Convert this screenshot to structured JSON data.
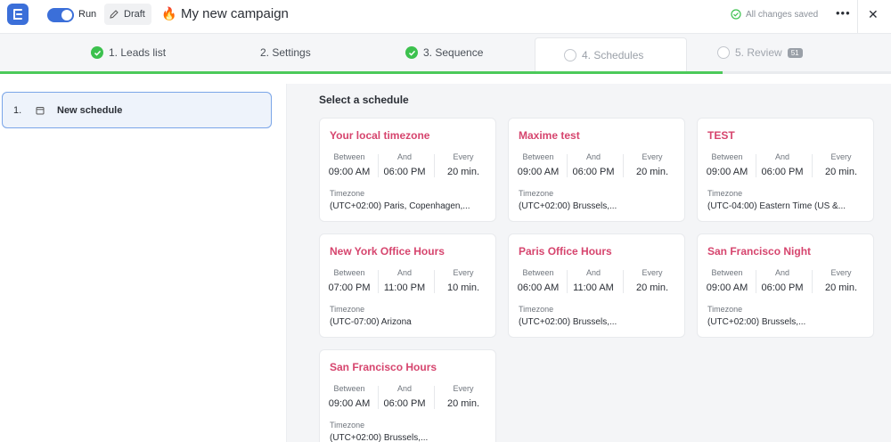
{
  "header": {
    "run_label": "Run",
    "draft_label": "Draft",
    "campaign_title": "My new campaign",
    "saved_status": "All changes saved",
    "more_label": "•••",
    "close_label": "✕"
  },
  "steps": [
    {
      "label": "1.  Leads list",
      "state": "done"
    },
    {
      "label": "2.  Settings",
      "state": "plain"
    },
    {
      "label": "3.  Sequence",
      "state": "done"
    },
    {
      "label": "4.  Schedules",
      "state": "current"
    },
    {
      "label": "5.  Review",
      "state": "todo",
      "badge": "51"
    }
  ],
  "sidebar": {
    "items": [
      {
        "number": "1.",
        "name": "New schedule"
      }
    ]
  },
  "main": {
    "section_title": "Select a schedule",
    "labels": {
      "between": "Between",
      "and": "And",
      "every": "Every",
      "timezone": "Timezone"
    },
    "schedules": [
      {
        "name": "Your local timezone",
        "between": "09:00 AM",
        "and": "06:00 PM",
        "every": "20 min.",
        "timezone": "(UTC+02:00) Paris,  Copenhagen,..."
      },
      {
        "name": "Maxime test",
        "between": "09:00 AM",
        "and": "06:00 PM",
        "every": "20 min.",
        "timezone": "(UTC+02:00) Brussels,..."
      },
      {
        "name": "TEST",
        "between": "09:00 AM",
        "and": "06:00 PM",
        "every": "20 min.",
        "timezone": "(UTC-04:00) Eastern Time (US &..."
      },
      {
        "name": "New York Office Hours",
        "between": "07:00 PM",
        "and": "11:00 PM",
        "every": "10 min.",
        "timezone": "(UTC-07:00) Arizona"
      },
      {
        "name": "Paris Office Hours",
        "between": "06:00 AM",
        "and": "11:00 AM",
        "every": "20 min.",
        "timezone": "(UTC+02:00) Brussels,..."
      },
      {
        "name": "San Francisco Night",
        "between": "09:00 AM",
        "and": "06:00 PM",
        "every": "20 min.",
        "timezone": "(UTC+02:00) Brussels,..."
      },
      {
        "name": "San Francisco Hours",
        "between": "09:00 AM",
        "and": "06:00 PM",
        "every": "20 min.",
        "timezone": "(UTC+02:00) Brussels,..."
      }
    ]
  },
  "colors": {
    "accent": "#3b6fd9",
    "success": "#3cc14e",
    "schedule_title": "#d6456e"
  }
}
